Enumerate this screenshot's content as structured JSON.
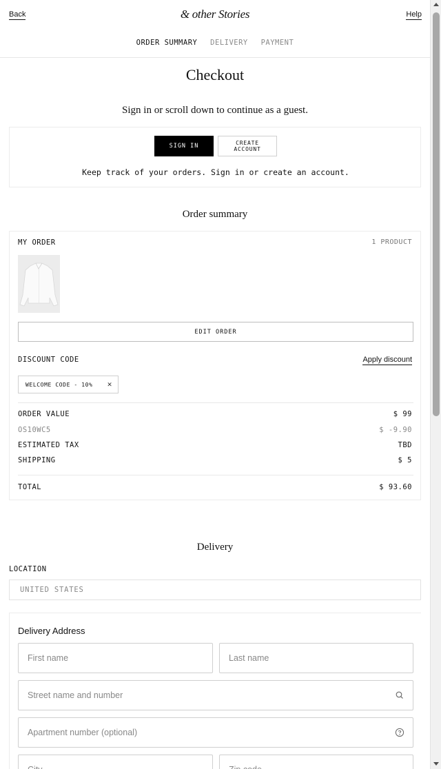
{
  "header": {
    "back_label": "Back",
    "logo_text": "& other Stories",
    "help_label": "Help",
    "steps": [
      {
        "label": "ORDER SUMMARY",
        "active": true
      },
      {
        "label": "DELIVERY",
        "active": false
      },
      {
        "label": "PAYMENT",
        "active": false
      }
    ]
  },
  "page_title": "Checkout",
  "guest_prompt": "Sign in or scroll down to continue as a guest.",
  "signin": {
    "sign_in_label": "SIGN IN",
    "create_account_label": "CREATE ACCOUNT",
    "note": "Keep track of your orders. Sign in or create an account."
  },
  "order_summary": {
    "title": "Order summary",
    "my_order_label": "MY ORDER",
    "product_count": "1 PRODUCT",
    "edit_order_label": "EDIT ORDER",
    "discount_code_label": "DISCOUNT CODE",
    "apply_discount_label": "Apply discount",
    "applied_code_chip": "WELCOME CODE - 10%",
    "lines": [
      {
        "label": "ORDER VALUE",
        "value": "$ 99",
        "muted": false
      },
      {
        "label": "OS10WC5",
        "value": "$ -9.90",
        "muted": true
      },
      {
        "label": "ESTIMATED TAX",
        "value": "TBD",
        "muted": false
      },
      {
        "label": "SHIPPING",
        "value": "$ 5",
        "muted": false
      }
    ],
    "total_label": "TOTAL",
    "total_value": "$ 93.60"
  },
  "delivery": {
    "title": "Delivery",
    "location_label": "LOCATION",
    "location_value": "UNITED STATES",
    "address_title": "Delivery Address",
    "fields": {
      "first_name": "First name",
      "last_name": "Last name",
      "street": "Street name and number",
      "apartment": "Apartment number (optional)",
      "city": "City",
      "zip": "Zip code"
    }
  },
  "icons": {
    "search": "search-icon",
    "help": "help-circle-icon",
    "close": "close-icon"
  }
}
